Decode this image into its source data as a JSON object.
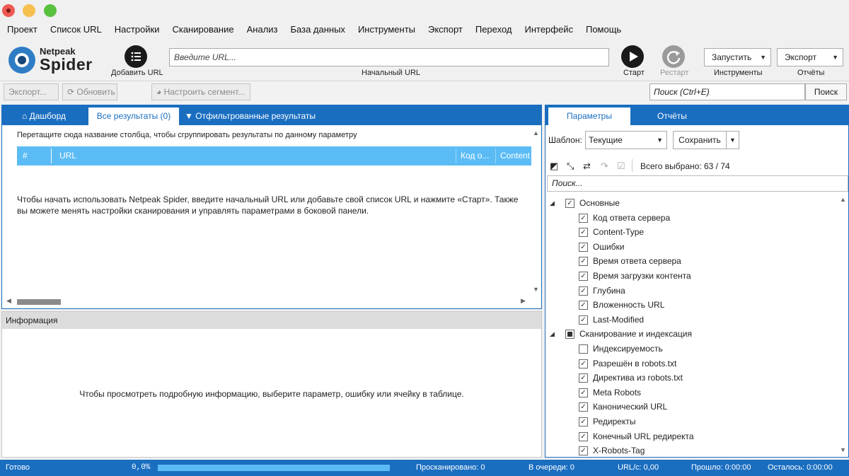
{
  "menu": [
    "Проект",
    "Список URL",
    "Настройки",
    "Сканирование",
    "Анализ",
    "База данных",
    "Инструменты",
    "Экспорт",
    "Переход",
    "Интерфейс",
    "Помощь"
  ],
  "logo": {
    "line1": "Netpeak",
    "line2": "Spider"
  },
  "toolbar": {
    "add_url_label": "Добавить URL",
    "url_placeholder": "Введите URL...",
    "url_caption": "Начальный URL",
    "start_label": "Старт",
    "restart_label": "Рестарт",
    "run_dropdown": "Запустить",
    "tools_caption": "Инструменты",
    "export_dropdown": "Экспорт",
    "reports_caption": "Отчёты"
  },
  "toolbar2": {
    "export_btn": "Экспорт...",
    "refresh_btn": "Обновить",
    "segment_btn": "Настроить сегмент...",
    "search_placeholder": "Поиск (Ctrl+E)",
    "search_btn": "Поиск"
  },
  "results": {
    "tabs": [
      "Дашборд",
      "Все результаты (0)",
      "Отфильтрованные результаты"
    ],
    "group_hint": "Перетащите сюда название столбца, чтобы сгруппировать результаты по данному параметру",
    "columns": [
      "#",
      "URL",
      "Код о...",
      "Content"
    ],
    "empty_message": "Чтобы начать использовать Netpeak Spider, введите начальный URL или добавьте свой список URL и нажмите «Старт». Также вы можете менять настройки сканирования и управлять параметрами в боковой панели."
  },
  "info": {
    "title": "Информация",
    "message": "Чтобы просмотреть подробную информацию, выберите параметр, ошибку или ячейку в таблице."
  },
  "params": {
    "tabs": [
      "Параметры",
      "Отчёты"
    ],
    "template_label": "Шаблон:",
    "template_value": "Текущие",
    "save_label": "Сохранить",
    "total_selected": "Всего выбрано: 63 / 74",
    "search_placeholder": "Поиск...",
    "groups": [
      {
        "name": "Основные",
        "state": "checked",
        "items": [
          {
            "label": "Код ответа сервера",
            "checked": true
          },
          {
            "label": "Content-Type",
            "checked": true
          },
          {
            "label": "Ошибки",
            "checked": true
          },
          {
            "label": "Время ответа сервера",
            "checked": true
          },
          {
            "label": "Время загрузки контента",
            "checked": true
          },
          {
            "label": "Глубина",
            "checked": true
          },
          {
            "label": "Вложенность URL",
            "checked": true
          },
          {
            "label": "Last-Modified",
            "checked": true
          }
        ]
      },
      {
        "name": "Сканирование и индексация",
        "state": "partial",
        "items": [
          {
            "label": "Индексируемость",
            "checked": false
          },
          {
            "label": "Разрешён в robots.txt",
            "checked": true
          },
          {
            "label": "Директива из robots.txt",
            "checked": true
          },
          {
            "label": "Meta Robots",
            "checked": true
          },
          {
            "label": "Канонический URL",
            "checked": true
          },
          {
            "label": "Редиректы",
            "checked": true
          },
          {
            "label": "Конечный URL редиректа",
            "checked": true
          },
          {
            "label": "X-Robots-Tag",
            "checked": true
          }
        ]
      }
    ]
  },
  "status": {
    "state": "Готово",
    "percent": "0,0%",
    "progress": 0,
    "scanned": "Просканировано: 0",
    "queue": "В очереди: 0",
    "rate": "URL/с: 0,00",
    "elapsed": "Прошло: 0:00:00",
    "remaining": "Осталось: 0:00:00"
  },
  "colors": {
    "accent": "#1a6ec0",
    "table_header": "#5bbcf5",
    "progress": "#5bbcf5"
  }
}
